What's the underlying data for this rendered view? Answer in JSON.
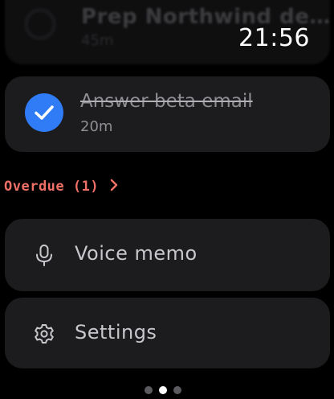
{
  "clock": {
    "time": "21:56"
  },
  "tasks": [
    {
      "title": "Prep Northwind de…",
      "duration": "45m",
      "completed": false
    },
    {
      "title": "Answer beta email",
      "duration": "20m",
      "completed": true
    }
  ],
  "overdue": {
    "label": "Overdue (1)"
  },
  "actions": {
    "voice_memo": {
      "label": "Voice memo",
      "icon": "microphone-icon"
    },
    "settings": {
      "label": "Settings",
      "icon": "gear-icon"
    }
  },
  "page_indicator": {
    "count": 3,
    "active_index": 1
  },
  "colors": {
    "background": "#000000",
    "card": "#1c1c1e",
    "checkmark": "#2f7cf6",
    "overdue": "#ef7066"
  }
}
